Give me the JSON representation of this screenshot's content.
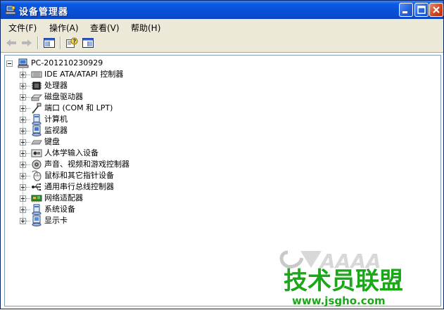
{
  "window": {
    "title": "设备管理器"
  },
  "menu": [
    {
      "label": "文件(F)"
    },
    {
      "label": "操作(A)"
    },
    {
      "label": "查看(V)"
    },
    {
      "label": "帮助(H)"
    }
  ],
  "toolbar": {
    "icons": [
      "back-arrow-icon",
      "forward-arrow-icon",
      "console-tree-icon",
      "properties-help-icon",
      "show-hide-icon"
    ]
  },
  "tree": {
    "root": "PC-201210230929",
    "children": [
      {
        "label": "IDE ATA/ATAPI 控制器",
        "icon": "ide-controller-icon"
      },
      {
        "label": "处理器",
        "icon": "processor-icon"
      },
      {
        "label": "磁盘驱动器",
        "icon": "disk-drive-icon"
      },
      {
        "label": "端口 (COM 和 LPT)",
        "icon": "port-icon"
      },
      {
        "label": "计算机",
        "icon": "computer-icon"
      },
      {
        "label": "监视器",
        "icon": "monitor-icon"
      },
      {
        "label": "键盘",
        "icon": "keyboard-icon"
      },
      {
        "label": "人体学输入设备",
        "icon": "hid-icon"
      },
      {
        "label": "声音、视频和游戏控制器",
        "icon": "sound-icon"
      },
      {
        "label": "鼠标和其它指针设备",
        "icon": "mouse-icon"
      },
      {
        "label": "通用串行总线控制器",
        "icon": "usb-icon"
      },
      {
        "label": "网络适配器",
        "icon": "network-adapter-icon"
      },
      {
        "label": "系统设备",
        "icon": "system-device-icon"
      },
      {
        "label": "显示卡",
        "icon": "display-adapter-icon"
      }
    ]
  },
  "watermark": {
    "line1": "技术员联盟",
    "line2": "www.jsgho.com"
  },
  "colors": {
    "title_bar": "#0a4ccf",
    "watermark_green": "#1aa818"
  }
}
